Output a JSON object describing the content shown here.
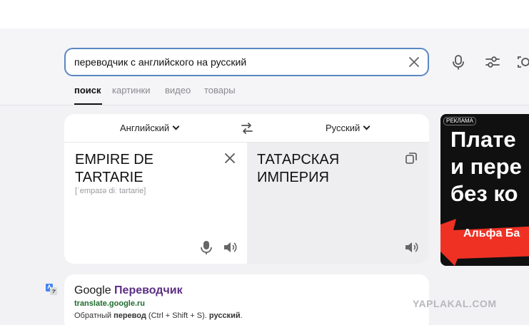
{
  "search": {
    "query": "переводчик с английского на русский"
  },
  "tabs": [
    {
      "label": "поиск"
    },
    {
      "label": "картинки"
    },
    {
      "label": "видео"
    },
    {
      "label": "товары"
    }
  ],
  "translator": {
    "source_lang": "Английский",
    "target_lang": "Русский",
    "source_line1": "EMPIRE DE",
    "source_line2": "TARTARIE",
    "transliteration": "[ˈempаɪə diː tartarie]",
    "target_line1": "ТАТАРСКАЯ",
    "target_line2": "ИМПЕРИЯ"
  },
  "ad": {
    "badge": "РЕКЛАМА",
    "line1": "Плате",
    "line2": "и пере",
    "line3": "без ко",
    "brand": "Альфа Ба",
    "colors": {
      "accent": "#ef3124",
      "bg": "#101010"
    }
  },
  "result": {
    "title_prefix": "Google",
    "title_bold": "Переводчик",
    "url": "translate.google.ru",
    "snippet_pre": "Обратный",
    "snippet_bold1": "перевод",
    "snippet_mid": "(Ctrl + Shift + S).",
    "snippet_bold2": "русский",
    "snippet_end": "."
  },
  "watermark": "YAPLAKAL.COM",
  "icons": [
    "clear-icon",
    "microphone-icon",
    "filter-settings-icon",
    "camera-search-icon",
    "swap-languages-icon",
    "copy-icon",
    "speaker-icon",
    "google-translate-icon"
  ]
}
